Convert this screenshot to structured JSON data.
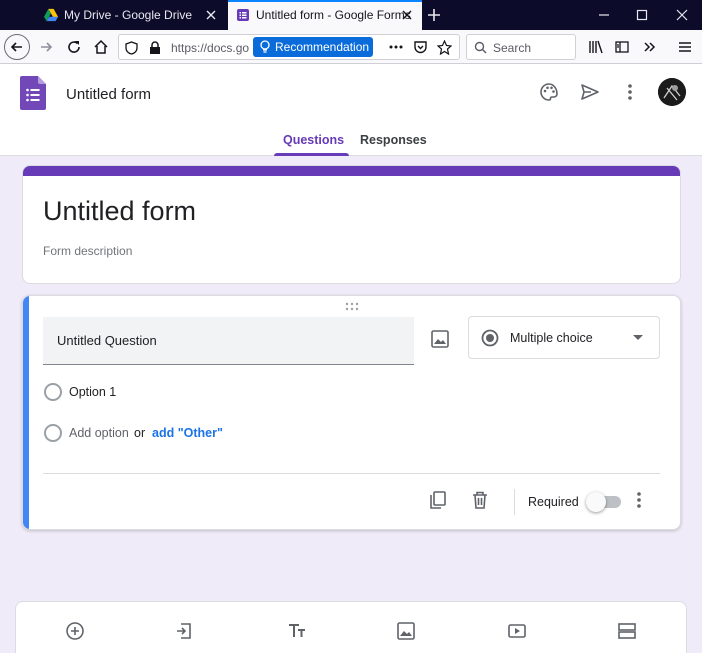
{
  "browser": {
    "tabs": [
      {
        "label": "My Drive - Google Drive",
        "active": false
      },
      {
        "label": "Untitled form - Google Forms",
        "active": true
      }
    ],
    "url": "https://docs.go",
    "recommendation_label": "Recommendation",
    "search_placeholder": "Search"
  },
  "header": {
    "doc_title": "Untitled form",
    "tabs": [
      {
        "label": "Questions",
        "active": true
      },
      {
        "label": "Responses",
        "active": false
      }
    ]
  },
  "form": {
    "title": "Untitled form",
    "description_placeholder": "Form description"
  },
  "question": {
    "title": "Untitled Question",
    "type": "Multiple choice",
    "options": [
      "Option 1"
    ],
    "add_option_label": "Add option",
    "or_label": "or",
    "add_other_label": "add \"Other\"",
    "required_label": "Required",
    "required": false
  },
  "colors": {
    "accent": "#673ab7",
    "focus_bar": "#4285f4",
    "background": "#f0ebf8",
    "link": "#1a73e8"
  }
}
